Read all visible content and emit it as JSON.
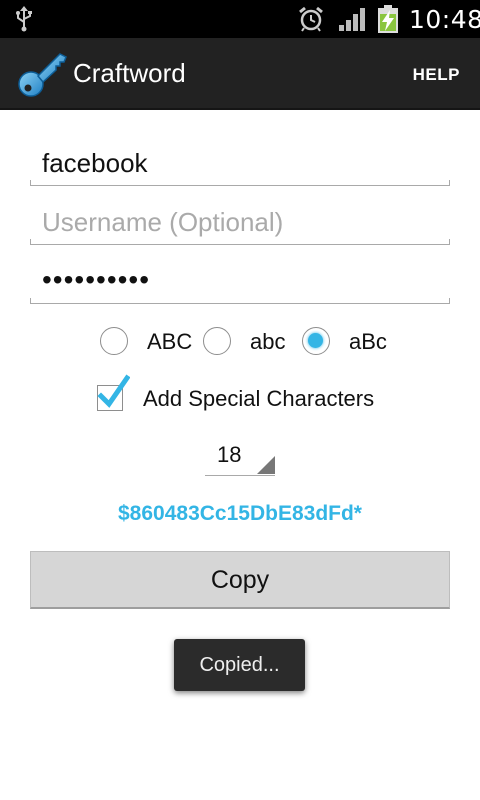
{
  "status_bar": {
    "time": "10:48",
    "icons": [
      "usb-icon",
      "alarm-icon",
      "signal-icon",
      "battery-charging-icon"
    ]
  },
  "action_bar": {
    "title": "Craftword",
    "app_icon": "key-icon",
    "help_label": "HELP"
  },
  "form": {
    "site_value": "facebook",
    "username_value": "",
    "username_placeholder": "Username (Optional)",
    "password_display": "••••••••••",
    "case_options": [
      {
        "label": "ABC",
        "checked": false
      },
      {
        "label": "abc",
        "checked": false
      },
      {
        "label": "aBc",
        "checked": true
      }
    ],
    "special_chars_label": "Add Special Characters",
    "special_chars_checked": true,
    "length_value": "18",
    "generated_password": "$860483Cc15DbE83dFd*",
    "copy_label": "Copy"
  },
  "toast": {
    "text": "Copied..."
  },
  "colors": {
    "accent": "#33b5e5",
    "action_bar": "#222222",
    "status_bar": "#000000"
  }
}
